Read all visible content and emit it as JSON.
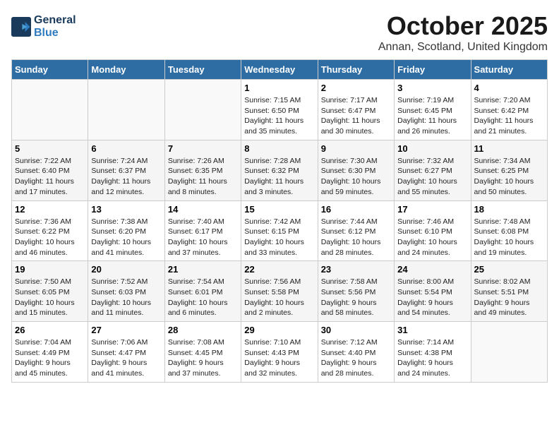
{
  "header": {
    "logo_line1": "General",
    "logo_line2": "Blue",
    "month_title": "October 2025",
    "location": "Annan, Scotland, United Kingdom"
  },
  "weekdays": [
    "Sunday",
    "Monday",
    "Tuesday",
    "Wednesday",
    "Thursday",
    "Friday",
    "Saturday"
  ],
  "weeks": [
    [
      {
        "num": "",
        "info": ""
      },
      {
        "num": "",
        "info": ""
      },
      {
        "num": "",
        "info": ""
      },
      {
        "num": "1",
        "info": "Sunrise: 7:15 AM\nSunset: 6:50 PM\nDaylight: 11 hours\nand 35 minutes."
      },
      {
        "num": "2",
        "info": "Sunrise: 7:17 AM\nSunset: 6:47 PM\nDaylight: 11 hours\nand 30 minutes."
      },
      {
        "num": "3",
        "info": "Sunrise: 7:19 AM\nSunset: 6:45 PM\nDaylight: 11 hours\nand 26 minutes."
      },
      {
        "num": "4",
        "info": "Sunrise: 7:20 AM\nSunset: 6:42 PM\nDaylight: 11 hours\nand 21 minutes."
      }
    ],
    [
      {
        "num": "5",
        "info": "Sunrise: 7:22 AM\nSunset: 6:40 PM\nDaylight: 11 hours\nand 17 minutes."
      },
      {
        "num": "6",
        "info": "Sunrise: 7:24 AM\nSunset: 6:37 PM\nDaylight: 11 hours\nand 12 minutes."
      },
      {
        "num": "7",
        "info": "Sunrise: 7:26 AM\nSunset: 6:35 PM\nDaylight: 11 hours\nand 8 minutes."
      },
      {
        "num": "8",
        "info": "Sunrise: 7:28 AM\nSunset: 6:32 PM\nDaylight: 11 hours\nand 3 minutes."
      },
      {
        "num": "9",
        "info": "Sunrise: 7:30 AM\nSunset: 6:30 PM\nDaylight: 10 hours\nand 59 minutes."
      },
      {
        "num": "10",
        "info": "Sunrise: 7:32 AM\nSunset: 6:27 PM\nDaylight: 10 hours\nand 55 minutes."
      },
      {
        "num": "11",
        "info": "Sunrise: 7:34 AM\nSunset: 6:25 PM\nDaylight: 10 hours\nand 50 minutes."
      }
    ],
    [
      {
        "num": "12",
        "info": "Sunrise: 7:36 AM\nSunset: 6:22 PM\nDaylight: 10 hours\nand 46 minutes."
      },
      {
        "num": "13",
        "info": "Sunrise: 7:38 AM\nSunset: 6:20 PM\nDaylight: 10 hours\nand 41 minutes."
      },
      {
        "num": "14",
        "info": "Sunrise: 7:40 AM\nSunset: 6:17 PM\nDaylight: 10 hours\nand 37 minutes."
      },
      {
        "num": "15",
        "info": "Sunrise: 7:42 AM\nSunset: 6:15 PM\nDaylight: 10 hours\nand 33 minutes."
      },
      {
        "num": "16",
        "info": "Sunrise: 7:44 AM\nSunset: 6:12 PM\nDaylight: 10 hours\nand 28 minutes."
      },
      {
        "num": "17",
        "info": "Sunrise: 7:46 AM\nSunset: 6:10 PM\nDaylight: 10 hours\nand 24 minutes."
      },
      {
        "num": "18",
        "info": "Sunrise: 7:48 AM\nSunset: 6:08 PM\nDaylight: 10 hours\nand 19 minutes."
      }
    ],
    [
      {
        "num": "19",
        "info": "Sunrise: 7:50 AM\nSunset: 6:05 PM\nDaylight: 10 hours\nand 15 minutes."
      },
      {
        "num": "20",
        "info": "Sunrise: 7:52 AM\nSunset: 6:03 PM\nDaylight: 10 hours\nand 11 minutes."
      },
      {
        "num": "21",
        "info": "Sunrise: 7:54 AM\nSunset: 6:01 PM\nDaylight: 10 hours\nand 6 minutes."
      },
      {
        "num": "22",
        "info": "Sunrise: 7:56 AM\nSunset: 5:58 PM\nDaylight: 10 hours\nand 2 minutes."
      },
      {
        "num": "23",
        "info": "Sunrise: 7:58 AM\nSunset: 5:56 PM\nDaylight: 9 hours\nand 58 minutes."
      },
      {
        "num": "24",
        "info": "Sunrise: 8:00 AM\nSunset: 5:54 PM\nDaylight: 9 hours\nand 54 minutes."
      },
      {
        "num": "25",
        "info": "Sunrise: 8:02 AM\nSunset: 5:51 PM\nDaylight: 9 hours\nand 49 minutes."
      }
    ],
    [
      {
        "num": "26",
        "info": "Sunrise: 7:04 AM\nSunset: 4:49 PM\nDaylight: 9 hours\nand 45 minutes."
      },
      {
        "num": "27",
        "info": "Sunrise: 7:06 AM\nSunset: 4:47 PM\nDaylight: 9 hours\nand 41 minutes."
      },
      {
        "num": "28",
        "info": "Sunrise: 7:08 AM\nSunset: 4:45 PM\nDaylight: 9 hours\nand 37 minutes."
      },
      {
        "num": "29",
        "info": "Sunrise: 7:10 AM\nSunset: 4:43 PM\nDaylight: 9 hours\nand 32 minutes."
      },
      {
        "num": "30",
        "info": "Sunrise: 7:12 AM\nSunset: 4:40 PM\nDaylight: 9 hours\nand 28 minutes."
      },
      {
        "num": "31",
        "info": "Sunrise: 7:14 AM\nSunset: 4:38 PM\nDaylight: 9 hours\nand 24 minutes."
      },
      {
        "num": "",
        "info": ""
      }
    ]
  ]
}
